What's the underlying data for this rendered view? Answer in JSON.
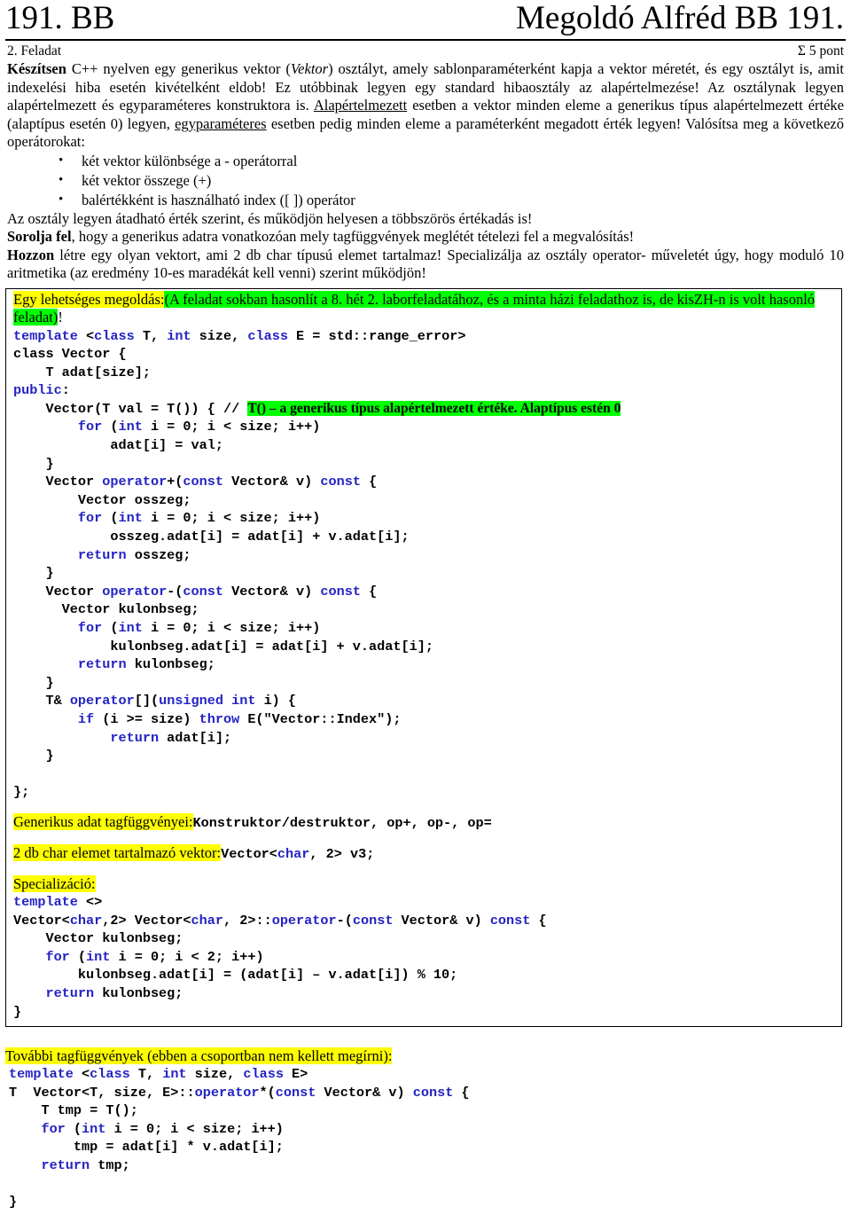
{
  "header": {
    "left_title": "191. BB",
    "right_title": "Megoldó Alfréd BB 191."
  },
  "meta": {
    "task_label": "2. Feladat",
    "points": "Σ 5 pont"
  },
  "description": {
    "para1_bold": "Készítsen",
    "para1_a": " C++ nyelven egy generikus vektor (",
    "para1_italic": "Vektor",
    "para1_b": ") osztályt, amely sablonparaméterként kapja a vektor méretét, és egy osztályt is, amit indexelési hiba esetén kivételként eldob! Ez utóbbinak legyen egy standard hibaosztály az alapértelmezése! Az osztálynak legyen alapértelmezett és egyparaméteres konstruktora is. ",
    "para1_u1": "Alapértelmezett",
    "para1_c": " esetben a vektor minden eleme a generikus típus alapértelmezett értéke (alaptípus esetén 0) legyen, ",
    "para1_u2": "egyparaméteres",
    "para1_d": " esetben pedig minden eleme a paraméterként megadott érték legyen! Valósítsa meg a következő operátorokat:",
    "bullets": [
      "két vektor különbsége a - operátorral",
      "két vektor összege (+)",
      "balértékként is használható index ([ ]) operátor"
    ],
    "para2": "Az osztály legyen átadható érték szerint, és működjön helyesen a többszörös értékadás is!",
    "para3_bold": "Sorolja fel",
    "para3_rest": ", hogy a generikus adatra vonatkozóan mely tagfüggvények meglétét tételezi fel a megvalósítás!",
    "para4_bold": "Hozzon",
    "para4_rest": " létre egy olyan vektort, ami 2 db char típusú elemet tartalmaz! Specializálja az osztály operator- műveletét úgy, hogy moduló 10 aritmetika (az eredmény 10-es maradékát kell venni) szerint működjön!"
  },
  "solution": {
    "note_yellow": "Egy lehetséges megoldás:",
    "note_green": "(A feladat sokban hasonlít a 8. hét 2. laborfeladatához, és a minta házi feladathoz is, de kisZH-n is volt hasonló feladat)",
    "note_tail": "!",
    "code_line_1_kw1": "template",
    "code_line_1_t1": " <",
    "code_line_1_kw2": "class",
    "code_line_1_t2": " T, ",
    "code_line_1_kw3": "int",
    "code_line_1_t3": " size, ",
    "code_line_1_kw4": "class",
    "code_line_1_t4": " E = std::range_error>",
    "code_line_2": "class Vector {",
    "code_line_3": "    T adat[size];",
    "code_line_4_kw": "public",
    "code_line_4_t": ":",
    "code_line_5_t1": "    Vector(T val = T()) { // ",
    "code_line_5_comment": "T() – a generikus típus alapértelmezett értéke. Alaptípus estén 0",
    "code_line_6_kw1": "        for",
    "code_line_6_t1": " (",
    "code_line_6_kw2": "int",
    "code_line_6_t2": " i = 0; i < size; i++)",
    "code_line_7": "            adat[i] = val;",
    "code_line_8": "    }",
    "code_line_9_t1": "    Vector ",
    "code_line_9_kw1": "operator",
    "code_line_9_t2": "+(",
    "code_line_9_kw2": "const",
    "code_line_9_t3": " Vector& v) ",
    "code_line_9_kw3": "const",
    "code_line_9_t4": " {",
    "code_line_10": "        Vector osszeg;",
    "code_line_11_kw1": "        for",
    "code_line_11_t1": " (",
    "code_line_11_kw2": "int",
    "code_line_11_t2": " i = 0; i < size; i++)",
    "code_line_12": "            osszeg.adat[i] = adat[i] + v.adat[i];",
    "code_line_13_kw": "        return",
    "code_line_13_t": " osszeg;",
    "code_line_14": "    }",
    "code_line_15_t1": "    Vector ",
    "code_line_15_kw1": "operator",
    "code_line_15_t2": "-(",
    "code_line_15_kw2": "const",
    "code_line_15_t3": " Vector& v) ",
    "code_line_15_kw3": "const",
    "code_line_15_t4": " {",
    "code_line_16": "      Vector kulonbseg;",
    "code_line_17_kw1": "        for",
    "code_line_17_t1": " (",
    "code_line_17_kw2": "int",
    "code_line_17_t2": " i = 0; i < size; i++)",
    "code_line_18": "            kulonbseg.adat[i] = adat[i] + v.adat[i];",
    "code_line_19_kw": "        return",
    "code_line_19_t": " kulonbseg;",
    "code_line_20": "    }",
    "code_line_21_t1": "    T& ",
    "code_line_21_kw1": "operator",
    "code_line_21_t2": "[](",
    "code_line_21_kw2": "unsigned int",
    "code_line_21_t3": " i) {",
    "code_line_22_kw1": "        if",
    "code_line_22_t1": " (i >= size) ",
    "code_line_22_kw2": "throw",
    "code_line_22_t2": " E(\"Vector::Index\");",
    "code_line_23_kw": "            return",
    "code_line_23_t": " adat[i];",
    "code_line_24": "    }",
    "code_line_25": "};",
    "members_label": "Generikus adat tagfüggvényei:",
    "members_code": "Konstruktor/destruktor, op+, op-, op=",
    "vector_label": "2 db char elemet tartalmazó vektor:",
    "vector_code_t1": "Vector<",
    "vector_code_kw": "char",
    "vector_code_t2": ", 2> v3;",
    "spec_label": "Specializáció:",
    "spec_line_1_kw": "template",
    "spec_line_1_t": " <>",
    "spec_line_2_t1": "Vector<",
    "spec_line_2_kw1": "char",
    "spec_line_2_t2": ",2> Vector<",
    "spec_line_2_kw2": "char",
    "spec_line_2_t3": ", 2>::",
    "spec_line_2_kw3": "operator",
    "spec_line_2_t4": "-(",
    "spec_line_2_kw4": "const",
    "spec_line_2_t5": " Vector& v) ",
    "spec_line_2_kw5": "const",
    "spec_line_2_t6": " {",
    "spec_line_3": "    Vector kulonbseg;",
    "spec_line_4_kw1": "    for",
    "spec_line_4_t1": " (",
    "spec_line_4_kw2": "int",
    "spec_line_4_t2": " i = 0; i < 2; i++)",
    "spec_line_5": "        kulonbseg.adat[i] = (adat[i] – v.adat[i]) % 10;",
    "spec_line_6_kw": "    return",
    "spec_line_6_t": " kulonbseg;",
    "spec_line_7": "}"
  },
  "tail": {
    "title": "További tagfüggvények (ebben a csoportban nem kellett megírni):",
    "line_1_kw1": "template",
    "line_1_t1": " <",
    "line_1_kw2": "class",
    "line_1_t2": " T, ",
    "line_1_kw3": "int",
    "line_1_t3": " size, ",
    "line_1_kw4": "class",
    "line_1_t4": " E>",
    "line_2_t1": "T  Vector<T, size, E>::",
    "line_2_kw1": "operator",
    "line_2_t2": "*(",
    "line_2_kw2": "const",
    "line_2_t3": " Vector& v) ",
    "line_2_kw3": "const",
    "line_2_t4": " {",
    "line_3": "    T tmp = T();",
    "line_4_kw1": "    for",
    "line_4_t1": " (",
    "line_4_kw2": "int",
    "line_4_t2": " i = 0; i < size; i++)",
    "line_5": "        tmp = adat[i] * v.adat[i];",
    "line_6_kw": "    return",
    "line_6_t": " tmp;",
    "line_7": "}"
  },
  "colors": {
    "keyword_blue": "#2323c4",
    "highlight_yellow": "#ffff00",
    "highlight_green": "#00ff00",
    "text_black": "#000000"
  }
}
